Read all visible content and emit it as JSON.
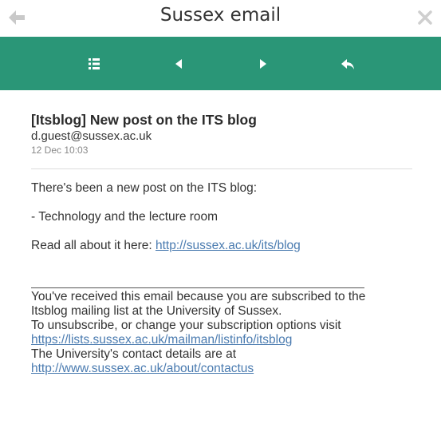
{
  "window": {
    "title": "Sussex email"
  },
  "toolbar": {
    "buttons": [
      {
        "icon": "list-icon"
      },
      {
        "icon": "previous-icon"
      },
      {
        "icon": "next-icon"
      },
      {
        "icon": "reply-icon"
      }
    ],
    "color": "#2a9677"
  },
  "message": {
    "subject": "[Itsblog] New post on the ITS blog",
    "sender": "d.guest@sussex.ac.uk",
    "date": "12 Dec 10:03",
    "body": {
      "line1": "There's been a new post on the ITS blog:",
      "line2": "- Technology and the lecture room",
      "line3_prefix": "Read all about it here: ",
      "line3_link": "http://sussex.ac.uk/its/blog"
    },
    "footer": {
      "line1": "You've received this email because you are subscribed to the",
      "line2": "Itsblog mailing list at the University of Sussex.",
      "line3": "To unsubscribe, or change your subscription options visit",
      "link1": "https://lists.sussex.ac.uk/mailman/listinfo/itsblog",
      "line4": "The University's contact details are at",
      "link2": "http://www.sussex.ac.uk/about/contactus"
    }
  }
}
